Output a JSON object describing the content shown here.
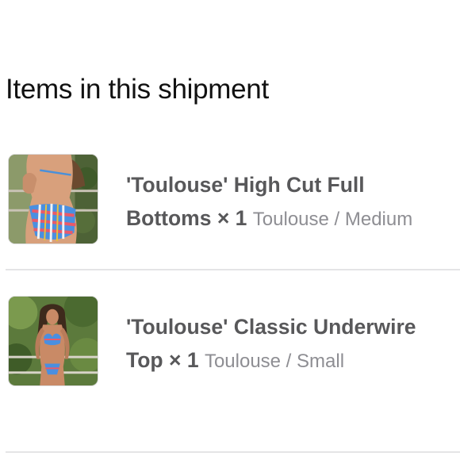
{
  "shipment": {
    "title": "Items in this shipment",
    "items": [
      {
        "name_line1": "'Toulouse' High Cut Full",
        "name_line2": "Bottoms",
        "quantity": "× 1",
        "variant": "Toulouse / Medium",
        "image_icon": "bikini-bottoms-product-photo"
      },
      {
        "name_line1": "'Toulouse' Classic Underwire",
        "name_line2": "Top",
        "quantity": "× 1",
        "variant": "Toulouse / Small",
        "image_icon": "bikini-top-product-photo"
      }
    ]
  },
  "colors": {
    "title_text": "#111111",
    "item_text": "#58585a",
    "variant_text": "#8e8e93",
    "divider": "#e4e4e6"
  }
}
